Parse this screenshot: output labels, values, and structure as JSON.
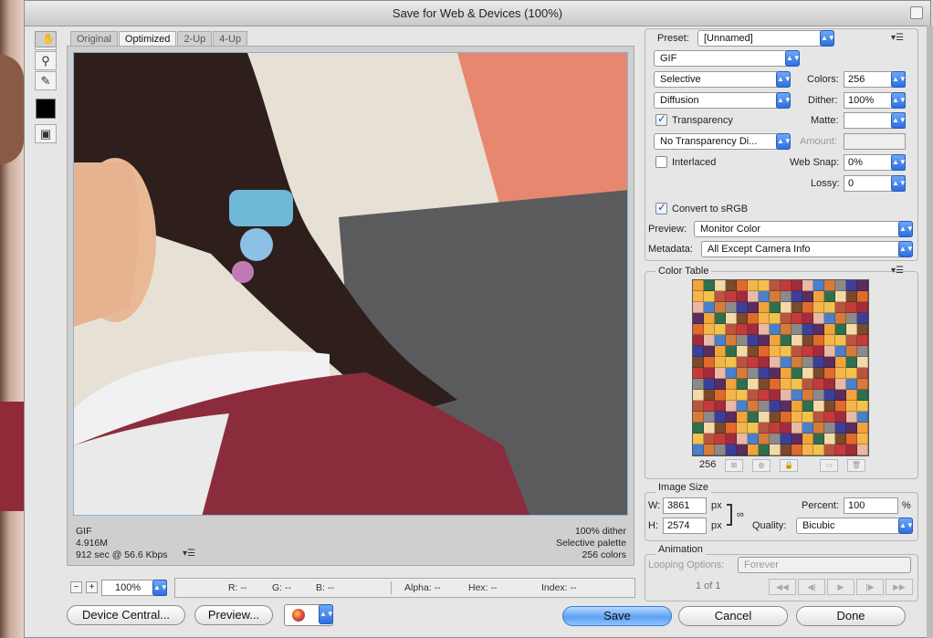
{
  "window": {
    "title": "Save for Web & Devices (100%)"
  },
  "tabs": [
    {
      "label": "Original"
    },
    {
      "label": "Optimized"
    },
    {
      "label": "2-Up"
    },
    {
      "label": "4-Up"
    }
  ],
  "image_info": {
    "format": "GIF",
    "size": "4.916M",
    "time": "912 sec @ 56.6 Kbps",
    "dither": "100% dither",
    "palette": "Selective palette",
    "colors": "256 colors"
  },
  "status": {
    "zoom": "100%",
    "r": "R: --",
    "g": "G: --",
    "b": "B: --",
    "alpha": "Alpha: --",
    "hex": "Hex: --",
    "index": "Index: --"
  },
  "buttons": {
    "device_central": "Device Central...",
    "preview": "Preview...",
    "save": "Save",
    "cancel": "Cancel",
    "done": "Done"
  },
  "settings": {
    "preset_label": "Preset:",
    "preset_value": "[Unnamed]",
    "format": "GIF",
    "reduction": "Selective",
    "colors_label": "Colors:",
    "colors_value": "256",
    "dither_algo": "Diffusion",
    "dither_label": "Dither:",
    "dither_value": "100%",
    "transparency_label": "Transparency",
    "matte_label": "Matte:",
    "trans_dither": "No Transparency Di...",
    "amount_label": "Amount:",
    "interlaced_label": "Interlaced",
    "websnap_label": "Web Snap:",
    "websnap_value": "0%",
    "lossy_label": "Lossy:",
    "lossy_value": "0",
    "convert_label": "Convert to sRGB",
    "preview_label": "Preview:",
    "preview_value": "Monitor Color",
    "metadata_label": "Metadata:",
    "metadata_value": "All Except Camera Info"
  },
  "color_table": {
    "title": "Color Table",
    "count": "256",
    "swatches": [
      "#f2a33a",
      "#b8543f",
      "#3c3f9a",
      "#f4b64a",
      "#d67b3a",
      "#7a4a2a",
      "#e8b9a6",
      "#2f6f4e",
      "#c53b3b",
      "#5a2d5c",
      "#f2c14e",
      "#8a8a8a",
      "#e06a2c",
      "#4b7fc8",
      "#f3d9a8",
      "#a12c3d"
    ]
  },
  "image_size": {
    "title": "Image Size",
    "w_label": "W:",
    "w_value": "3861",
    "h_label": "H:",
    "h_value": "2574",
    "unit": "px",
    "percent_label": "Percent:",
    "percent_value": "100",
    "percent_unit": "%",
    "quality_label": "Quality:",
    "quality_value": "Bicubic"
  },
  "animation": {
    "title": "Animation",
    "looping_label": "Looping Options:",
    "looping_value": "Forever",
    "frame": "1 of 1"
  }
}
